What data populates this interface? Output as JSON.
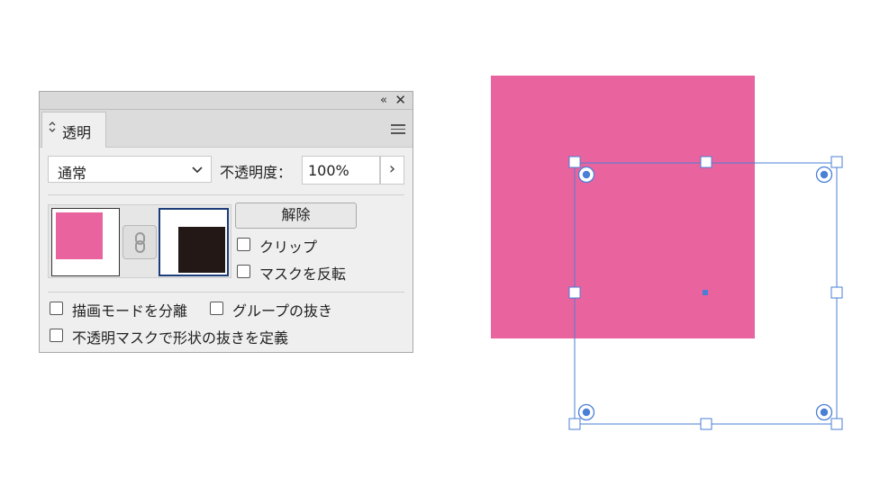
{
  "panel": {
    "collapse_icon": "«",
    "close_icon": "✕",
    "tab": {
      "label": "透明",
      "arrows_icon": "up-down-arrows-icon"
    },
    "menu_icon": "hamburger-menu-icon",
    "blend_mode": {
      "value": "通常"
    },
    "opacity": {
      "label": "不透明度：",
      "value": "100%",
      "arrow": "›"
    },
    "release_label": "解除",
    "clip_label": "クリップ",
    "invert_mask_label": "マスクを反転",
    "isolate_blending_label": "描画モードを分離",
    "knockout_group_label": "グループの抜き",
    "opacity_mask_knockout_label": "不透明マスクで形状の抜きを定義"
  },
  "colors": {
    "art_fill": "#e9639f",
    "mask_fill": "#231816",
    "selection": "#4a7fd6"
  }
}
